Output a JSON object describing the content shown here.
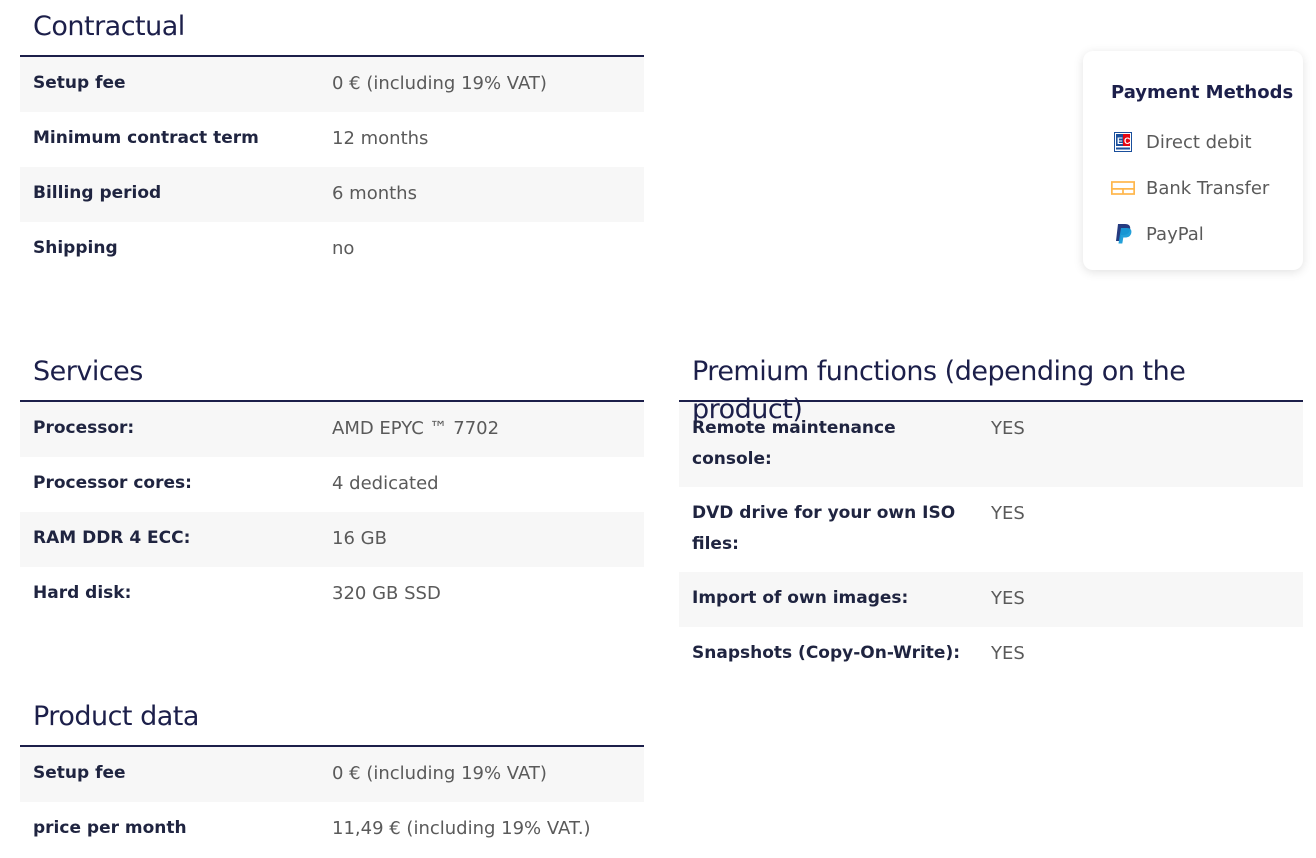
{
  "contractual": {
    "title": "Contractual",
    "rows": [
      {
        "label": "Setup fee",
        "value": "0 € (including 19% VAT)"
      },
      {
        "label": "Minimum contract term",
        "value": "12 months"
      },
      {
        "label": "Billing period",
        "value": "6 months"
      },
      {
        "label": "Shipping",
        "value": "no"
      }
    ]
  },
  "payment": {
    "title": "Payment Methods",
    "methods": [
      {
        "label": "Direct debit",
        "icon": "ec-card-icon"
      },
      {
        "label": "Bank Transfer",
        "icon": "bank-transfer-icon"
      },
      {
        "label": "PayPal",
        "icon": "paypal-icon"
      }
    ],
    "colors": {
      "bank_transfer": "#ffb74d",
      "paypal_dark": "#253b80",
      "paypal_light": "#179bd7",
      "ec_red": "#e30613",
      "ec_blue": "#1a4f9c"
    }
  },
  "services": {
    "title": "Services",
    "rows": [
      {
        "label": "Processor:",
        "value": "AMD EPYC ™ 7702"
      },
      {
        "label": "Processor cores:",
        "value": "4 dedicated"
      },
      {
        "label": "RAM DDR 4 ECC:",
        "value": "16 GB"
      },
      {
        "label": "Hard disk:",
        "value": "320 GB SSD"
      }
    ]
  },
  "premium": {
    "title": "Premium functions (depending on the product)",
    "rows": [
      {
        "label": "Remote maintenance console:",
        "value": "YES"
      },
      {
        "label": "DVD drive for your own ISO files:",
        "value": "YES"
      },
      {
        "label": "Import of own images:",
        "value": "YES"
      },
      {
        "label": "Snapshots (Copy-On-Write):",
        "value": "YES"
      }
    ]
  },
  "product": {
    "title": "Product data",
    "rows": [
      {
        "label": "Setup fee",
        "value": "0 € (including 19% VAT)"
      },
      {
        "label": "price per month",
        "value": "11,49 € (including 19% VAT.)"
      }
    ]
  }
}
